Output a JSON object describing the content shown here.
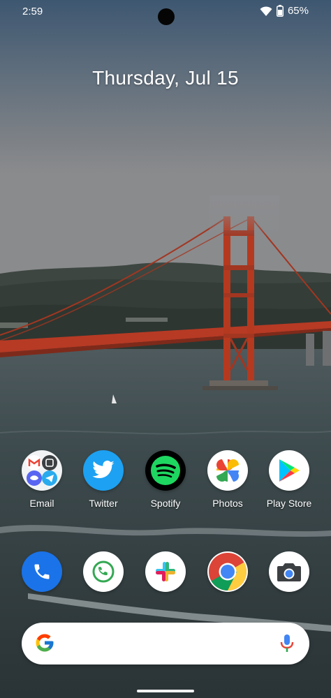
{
  "status_bar": {
    "time": "2:59",
    "battery": "65%",
    "battery_level": 0.65,
    "icons": [
      "wifi-icon",
      "battery-icon"
    ]
  },
  "date_widget": {
    "text": "Thursday, Jul 15"
  },
  "wallpaper": {
    "subject": "golden-gate-bridge"
  },
  "app_row": [
    {
      "label": "Email",
      "icon": "email-folder-icon"
    },
    {
      "label": "Twitter",
      "icon": "twitter-icon"
    },
    {
      "label": "Spotify",
      "icon": "spotify-icon"
    },
    {
      "label": "Photos",
      "icon": "google-photos-icon"
    },
    {
      "label": "Play Store",
      "icon": "play-store-icon"
    }
  ],
  "dock": [
    {
      "icon": "phone-icon"
    },
    {
      "icon": "phone-call-icon"
    },
    {
      "icon": "slack-icon"
    },
    {
      "icon": "chrome-icon"
    },
    {
      "icon": "camera-icon"
    }
  ],
  "search": {
    "icons": [
      "google-g-icon",
      "microphone-icon"
    ]
  },
  "colors": {
    "twitter": "#1DA1F2",
    "spotify_green": "#1ED760",
    "phone_blue": "#1A73E8",
    "chrome_green": "#34A853",
    "bridge_red": "#B73A24"
  }
}
